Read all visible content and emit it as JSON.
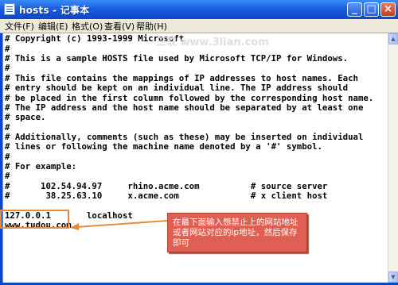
{
  "window": {
    "title": "hosts - 记事本",
    "controls": {
      "minimize": "_",
      "maximize": "□",
      "close": "×"
    }
  },
  "menu": {
    "items": [
      "文件(F)",
      "编辑(E)",
      "格式(O)",
      "查看(V)",
      "帮助(H)"
    ]
  },
  "editor": {
    "lines": [
      "# Copyright (c) 1993-1999 Microsoft",
      "#",
      "# This is a sample HOSTS file used by Microsoft TCP/IP for Windows.",
      "#",
      "# This file contains the mappings of IP addresses to host names. Each",
      "# entry should be kept on an individual line. The IP address should",
      "# be placed in the first column followed by the corresponding host name.",
      "# The IP address and the host name should be separated by at least one",
      "# space.",
      "#",
      "# Additionally, comments (such as these) may be inserted on individual",
      "# lines or following the machine name denoted by a '#' symbol.",
      "#",
      "# For example:",
      "#",
      "#      102.54.94.97     rhino.acme.com          # source server",
      "#       38.25.63.10     x.acme.com              # x client host",
      "",
      "127.0.0.1       localhost",
      "www.tudou.com"
    ]
  },
  "annotation": {
    "callout_text": "在最下面输入想禁止上的网站地址或者网站对应的ip地址，然后保存即可",
    "highlight_color": "#e68a3e",
    "callout_color": "#df5f52"
  },
  "watermark": {
    "text": "三联 www.3lian.com"
  },
  "scrollbar": {
    "up": "▲",
    "down": "▼"
  }
}
